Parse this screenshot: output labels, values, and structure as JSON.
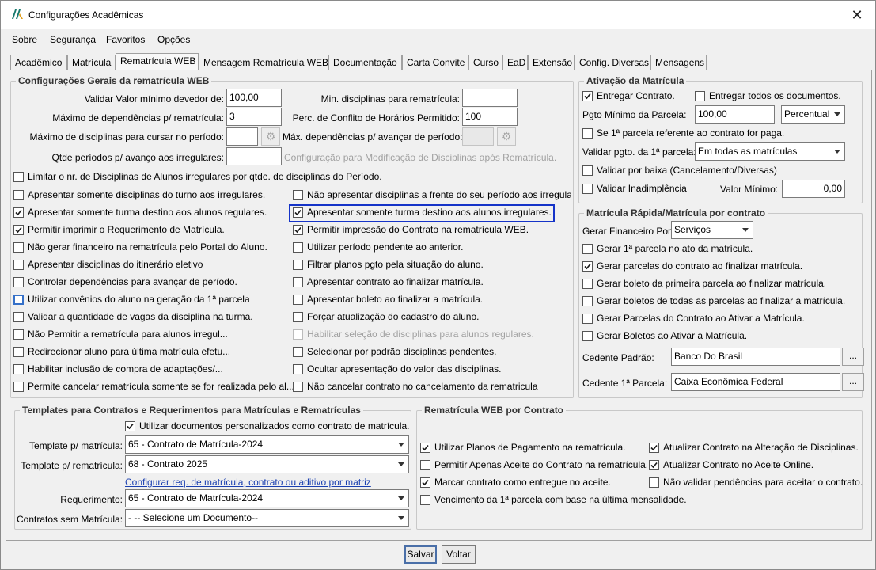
{
  "window": {
    "title": "Configurações Acadêmicas",
    "close": "✕"
  },
  "menu": [
    "Sobre",
    "Segurança",
    "Favoritos",
    "Opções"
  ],
  "tabs": [
    "Acadêmico",
    "Matrícula",
    "Rematrícula WEB",
    "Mensagem Rematrícula WEB",
    "Documentação",
    "Carta Convite",
    "Curso",
    "EaD",
    "Extensão",
    "Config. Diversas",
    "Mensagens"
  ],
  "general": {
    "legend": "Configurações Gerais da rematrícula WEB",
    "validar_valor_label": "Validar Valor mínimo devedor de:",
    "validar_valor": "100,00",
    "max_dependencias_label": "Máximo de dependências p/ rematrícula:",
    "max_dependencias": "3",
    "max_disciplinas_label": "Máximo de disciplinas para cursar no período:",
    "max_disciplinas": "",
    "qtde_periodos_label": "Qtde períodos p/ avanço aos irregulares:",
    "qtde_periodos": "",
    "min_disciplinas_label": "Min. disciplinas para rematrícula:",
    "min_disciplinas": "",
    "perc_conflito_label": "Perc. de Conflito de Horários Permitido:",
    "perc_conflito": "100",
    "max_dep_avancar_label": "Máx. dependências p/ avançar de período:",
    "max_dep_avancar": "",
    "config_modificacao": "Configuração para Modificação de Disciplinas após Rematrícula.",
    "limitar": "Limitar o nr. de Disciplinas de Alunos irregulares por qtde. de disciplinas do Período.",
    "left_checks": [
      "Apresentar somente disciplinas do turno aos irregulares.",
      "Apresentar somente turma destino aos alunos regulares.",
      "Permitir imprimir o Requerimento de Matrícula.",
      "Não gerar financeiro na rematrícula pelo Portal do Aluno.",
      "Apresentar disciplinas do itinerário eletivo",
      "Controlar dependências para avançar de período.",
      "Utilizar convênios do aluno na geração da 1ª parcela",
      "Validar a quantidade de vagas da disciplina na turma.",
      "Não Permitir a rematrícula para alunos irregul...",
      "Redirecionar aluno para última matrícula efetu...",
      "Habilitar inclusão de compra de adaptações/...",
      "Permite cancelar rematrícula somente se for realizada pelo al..."
    ],
    "right_checks": [
      "Não apresentar disciplinas a frente do seu período aos irregular",
      "Apresentar somente turma destino aos alunos irregulares.",
      "Permitir impressão do Contrato na rematrícula WEB.",
      "Utilizar período pendente ao anterior.",
      "Filtrar planos pgto pela situação do aluno.",
      "Apresentar contrato ao finalizar matrícula.",
      "Apresentar boleto ao finalizar a matrícula.",
      "Forçar atualização do cadastro do aluno.",
      "Habilitar seleção de disciplinas para alunos regulares.",
      "Selecionar por padrão disciplinas pendentes.",
      "Ocultar apresentação do valor das disciplinas.",
      "Não cancelar contrato no cancelamento da rematricula"
    ]
  },
  "ativacao": {
    "legend": "Ativação da Matrícula",
    "entregar_contrato": "Entregar Contrato.",
    "entregar_todos": "Entregar todos os documentos.",
    "pgto_minimo_label": "Pgto Mínimo da Parcela:",
    "pgto_minimo": "100,00",
    "pgto_tipo": "Percentual",
    "primeira_parcela": "Se 1ª parcela referente ao contrato for paga.",
    "validar_pgto_label": "Validar pgto. da 1ª parcela:",
    "validar_pgto": "Em todas as matrículas",
    "validar_baixa": "Validar por baixa (Cancelamento/Diversas)",
    "validar_inadimplencia": "Validar Inadimplência",
    "valor_minimo_label": "Valor Mínimo:",
    "valor_minimo": "0,00"
  },
  "rapida": {
    "legend": "Matrícula Rápida/Matrícula por contrato",
    "gerar_financeiro_label": "Gerar Financeiro Por:",
    "gerar_financeiro": "Serviços",
    "checks": [
      "Gerar 1ª parcela no ato da matrícula.",
      "Gerar parcelas do contrato ao finalizar matrícula.",
      "Gerar boleto da primeira parcela ao finalizar matrícula.",
      "Gerar boletos de todas as parcelas ao finalizar a matrícula.",
      "Gerar Parcelas do Contrato ao Ativar a Matrícula.",
      "Gerar Boletos ao Ativar a Matrícula."
    ],
    "cedente_padrao_label": "Cedente Padrão:",
    "cedente_padrao": "Banco Do Brasil",
    "cedente_parcela_label": "Cedente 1ª Parcela:",
    "cedente_parcela": "Caixa Econômica Federal",
    "dots": "..."
  },
  "templates": {
    "legend": "Templates para Contratos e Requerimentos para Matrículas e Rematrículas",
    "utilizar_docs": "Utilizar documentos personalizados como contrato de matrícula.",
    "template_matricula_label": "Template p/ matrícula:",
    "template_matricula": "65 - Contrato de Matrícula-2024",
    "template_rematricula_label": "Template p/ rematrícula:",
    "template_rematricula": "68 - Contrato 2025",
    "configurar_link": "Configurar req. de matrícula, contrato ou aditivo por matriz",
    "requerimento_label": "Requerimento:",
    "requerimento": "65 - Contrato de Matrícula-2024",
    "sem_matricula_label": "Contratos sem Matrícula:",
    "sem_matricula": "- -- Selecione um Documento--"
  },
  "web_contrato": {
    "legend": "Rematrícula WEB por Contrato",
    "left_checks": [
      "Utilizar Planos de Pagamento na rematrícula.",
      "Permitir Apenas Aceite do Contrato na rematrícula.",
      "Marcar contrato como entregue no aceite.",
      "Vencimento da 1ª parcela com base na última mensalidade."
    ],
    "right_checks": [
      "Atualizar Contrato na Alteração de Disciplinas.",
      "Atualizar Contrato no Aceite Online.",
      "Não validar pendências para aceitar o contrato."
    ]
  },
  "buttons": {
    "save": "Salvar",
    "back": "Voltar"
  }
}
